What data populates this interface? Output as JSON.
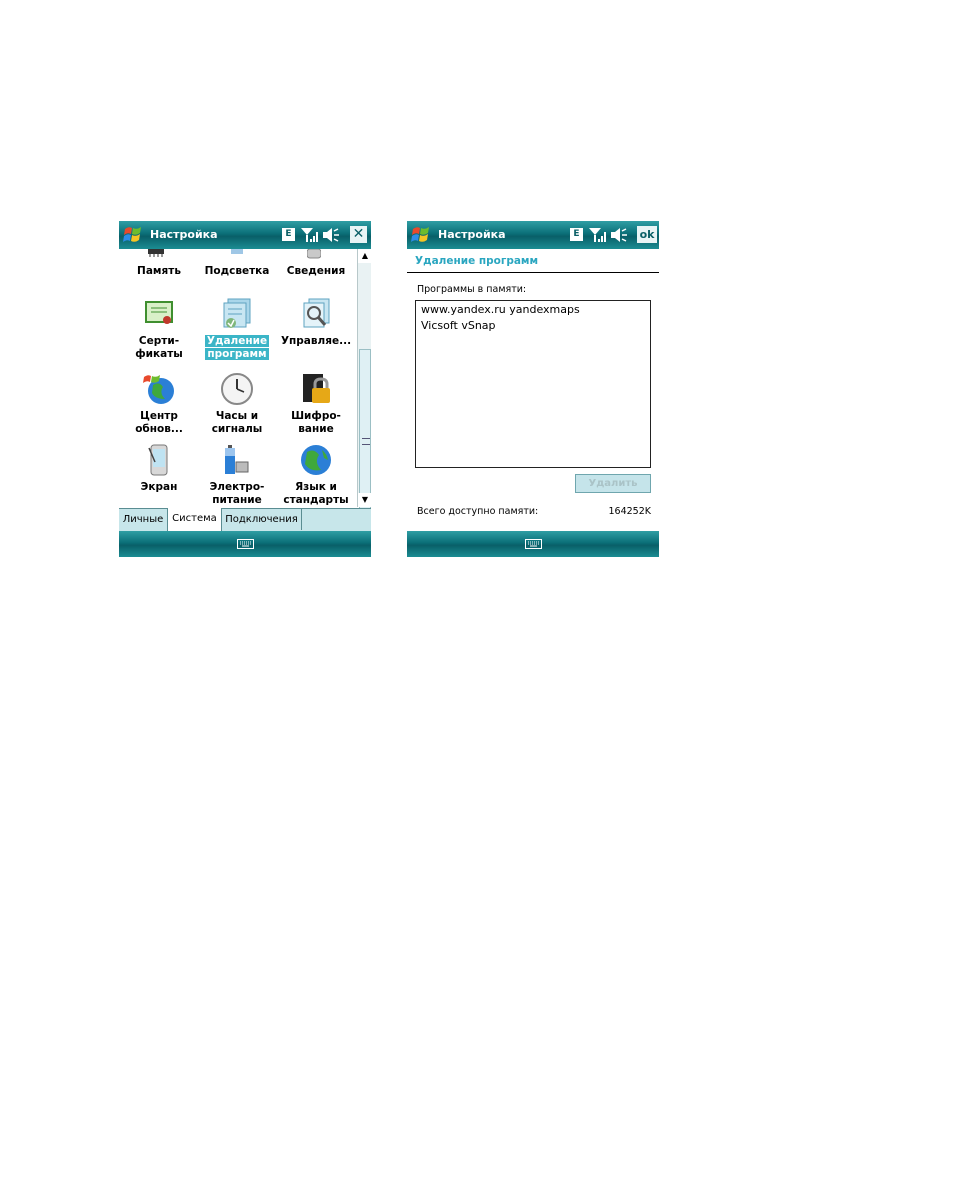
{
  "left": {
    "title": "Настройка",
    "e_label": "E",
    "close_label": "✕",
    "items": [
      {
        "label1": "Память",
        "label2": ""
      },
      {
        "label1": "Подсветка",
        "label2": ""
      },
      {
        "label1": "Сведения",
        "label2": ""
      },
      {
        "label1": "Серти-",
        "label2": "фикаты"
      },
      {
        "label1": "Удаление",
        "label2": "программ"
      },
      {
        "label1": "Управляе...",
        "label2": ""
      },
      {
        "label1": "Центр",
        "label2": "обнов..."
      },
      {
        "label1": "Часы и",
        "label2": "сигналы"
      },
      {
        "label1": "Шифро-",
        "label2": "вание"
      },
      {
        "label1": "Экран",
        "label2": ""
      },
      {
        "label1": "Электро-",
        "label2": "питание"
      },
      {
        "label1": "Язык и",
        "label2": "стандарты"
      }
    ],
    "tabs": [
      "Личные",
      "Система",
      "Подключения"
    ],
    "scroll_up": "▲",
    "scroll_down": "▼"
  },
  "right": {
    "title": "Настройка",
    "e_label": "E",
    "ok_label": "ok",
    "section_title": "Удаление программ",
    "list_label": "Программы в памяти:",
    "programs": [
      "www.yandex.ru yandexmaps",
      "Vicsoft vSnap"
    ],
    "delete_label": "Удалить",
    "memory_label": "Всего доступно памяти:",
    "memory_value": "164252K"
  }
}
